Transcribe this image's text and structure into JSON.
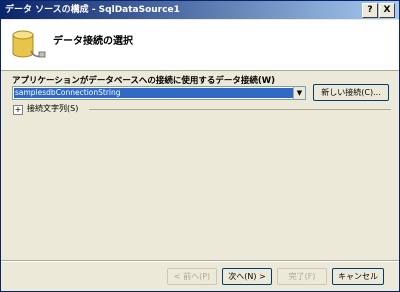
{
  "window": {
    "title": "データ ソースの構成 - SqlDataSource1",
    "help_glyph": "?",
    "close_glyph": "X"
  },
  "header": {
    "title": "データ接続の選択",
    "icon": "database-icon"
  },
  "connection": {
    "label": "アプリケーションがデータベースへの接続に使用するデータ接続(W)",
    "selected_value": "samplesdbConnectionString",
    "new_connection_button": "新しい接続(C)...",
    "expander_glyph": "+",
    "connection_string_label": "接続文字列(S)"
  },
  "footer": {
    "back_button": "< 前へ(P)",
    "next_button": "次へ(N) >",
    "finish_button": "完了(F)",
    "cancel_button": "キャンセル"
  },
  "colors": {
    "selection": "#316ac5",
    "titlebar_start": "#0a246a",
    "titlebar_end": "#a6caf0",
    "dialog_bg": "#ece9d8"
  }
}
